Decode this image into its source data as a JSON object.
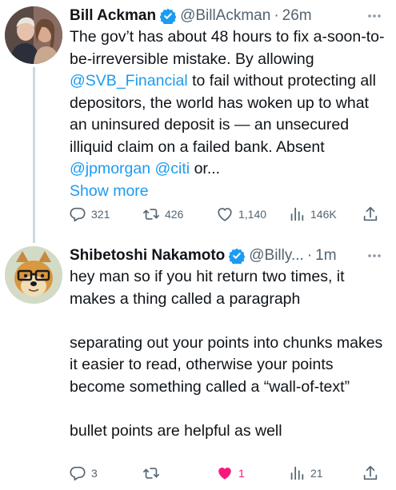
{
  "tweets": [
    {
      "display_name": "Bill Ackman",
      "handle": "@BillAckman",
      "separator": "·",
      "time": "26m",
      "text_parts": {
        "p1": "The gov’t has about 48 hours to fix a-soon-to-be-irreversible mistake. By allowing ",
        "mention1": "@SVB_Financial",
        "p2": " to fail without protecting all depositors, the world has woken up to what an uninsured deposit is — an unsecured illiquid claim on a failed bank. Absent ",
        "mention2": "@jpmorgan",
        "space": " ",
        "mention3": "@citi",
        "p3": " or...",
        "show_more": "Show more"
      },
      "stats": {
        "replies": "321",
        "retweets": "426",
        "likes": "1,140",
        "views": "146K"
      }
    },
    {
      "display_name": "Shibetoshi Nakamoto",
      "handle": "@Billy...",
      "separator": "·",
      "time": "1m",
      "paragraphs": [
        "hey man so if you hit return two times, it makes a thing called a paragraph",
        "separating out your points into chunks makes it easier to read, otherwise your points become something called a “wall-of-text”",
        "bullet points are helpful as well"
      ],
      "stats": {
        "replies": "3",
        "retweets": "",
        "likes": "1",
        "views": "21"
      }
    }
  ],
  "icons": {
    "verified": "verified-badge-icon",
    "more": "more-options-icon",
    "reply": "reply-icon",
    "retweet": "retweet-icon",
    "like": "heart-icon",
    "views": "views-chart-icon",
    "share": "share-icon"
  },
  "colors": {
    "text": "#0f1419",
    "secondary": "#536471",
    "link": "#1d9bf0",
    "like_active": "#f91880",
    "thread_line": "#cfd9de"
  }
}
